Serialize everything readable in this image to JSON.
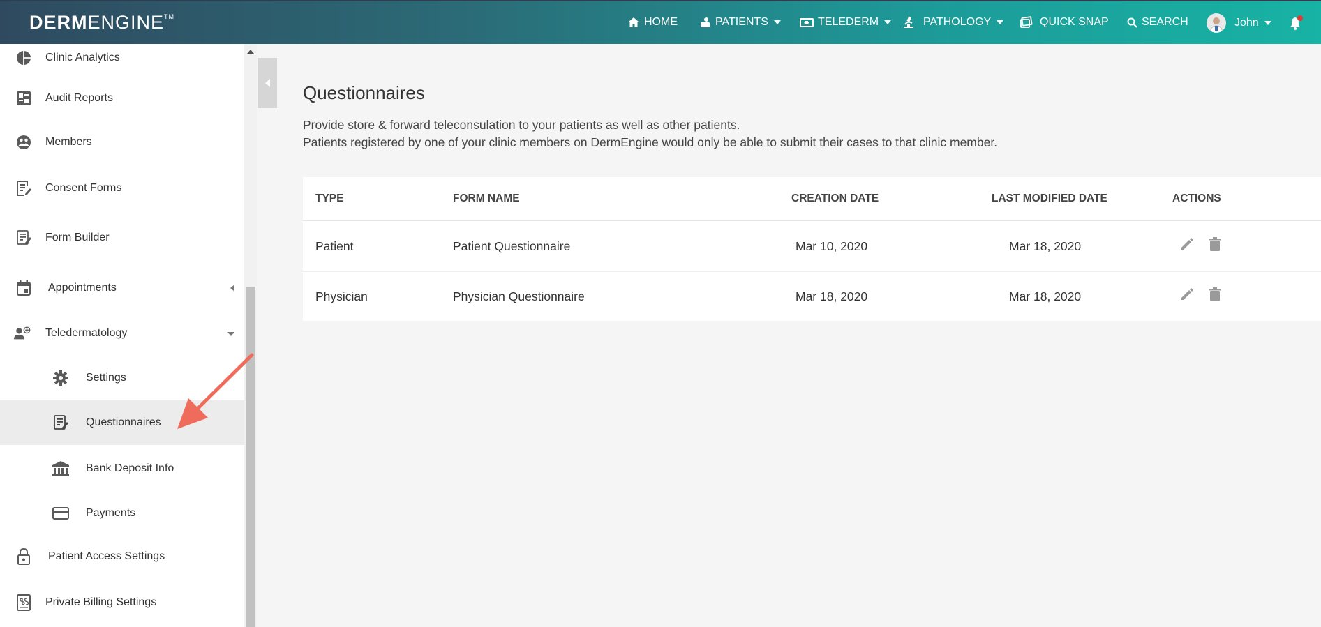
{
  "brand": {
    "part1": "DERM",
    "part2": "ENGINE",
    "tm": "TM"
  },
  "nav": [
    {
      "label": "HOME",
      "icon": "home-icon"
    },
    {
      "label": "PATIENTS",
      "icon": "patients-icon",
      "dropdown": true
    },
    {
      "label": "TELEDERM",
      "icon": "telederm-icon",
      "dropdown": true
    },
    {
      "label": "PATHOLOGY",
      "icon": "microscope-icon",
      "dropdown": true
    },
    {
      "label": "QUICK SNAP",
      "icon": "quick-snap-icon"
    },
    {
      "label": "SEARCH",
      "icon": "search-icon"
    }
  ],
  "user": {
    "name": "John"
  },
  "sidebar": {
    "items": [
      {
        "label": "Clinic Analytics",
        "icon": "pie-chart-icon"
      },
      {
        "label": "Audit Reports",
        "icon": "dashboard-icon"
      },
      {
        "label": "Members",
        "icon": "members-icon"
      },
      {
        "label": "Consent Forms",
        "icon": "edit-document-icon"
      },
      {
        "label": "Form Builder",
        "icon": "form-icon"
      },
      {
        "label": "Appointments",
        "icon": "calendar-icon"
      },
      {
        "label": "Teledermatology",
        "icon": "teledermatology-icon"
      },
      {
        "label": "Settings",
        "icon": "gear-icon"
      },
      {
        "label": "Questionnaires",
        "icon": "questionnaire-icon"
      },
      {
        "label": "Bank Deposit Info",
        "icon": "bank-icon"
      },
      {
        "label": "Payments",
        "icon": "credit-card-icon"
      },
      {
        "label": "Patient Access Settings",
        "icon": "lock-icon"
      },
      {
        "label": "Private Billing Settings",
        "icon": "billing-icon"
      }
    ]
  },
  "main": {
    "title": "Questionnaires",
    "desc1": "Provide store & forward teleconsulation to your patients as well as other patients.",
    "desc2": "Patients registered by one of your clinic members on DermEngine would only be able to submit their cases to that clinic member."
  },
  "table": {
    "headers": [
      "TYPE",
      "FORM NAME",
      "CREATION DATE",
      "LAST MODIFIED DATE",
      "ACTIONS"
    ],
    "rows": [
      {
        "type": "Patient",
        "form_name": "Patient Questionnaire",
        "created": "Mar 10, 2020",
        "modified": "Mar 18, 2020"
      },
      {
        "type": "Physician",
        "form_name": "Physician Questionnaire",
        "created": "Mar 18, 2020",
        "modified": "Mar 18, 2020"
      }
    ]
  },
  "colors": {
    "accent_arrow": "#ef6b5b",
    "header_start": "#2f4a5f",
    "header_end": "#17b3a4"
  }
}
